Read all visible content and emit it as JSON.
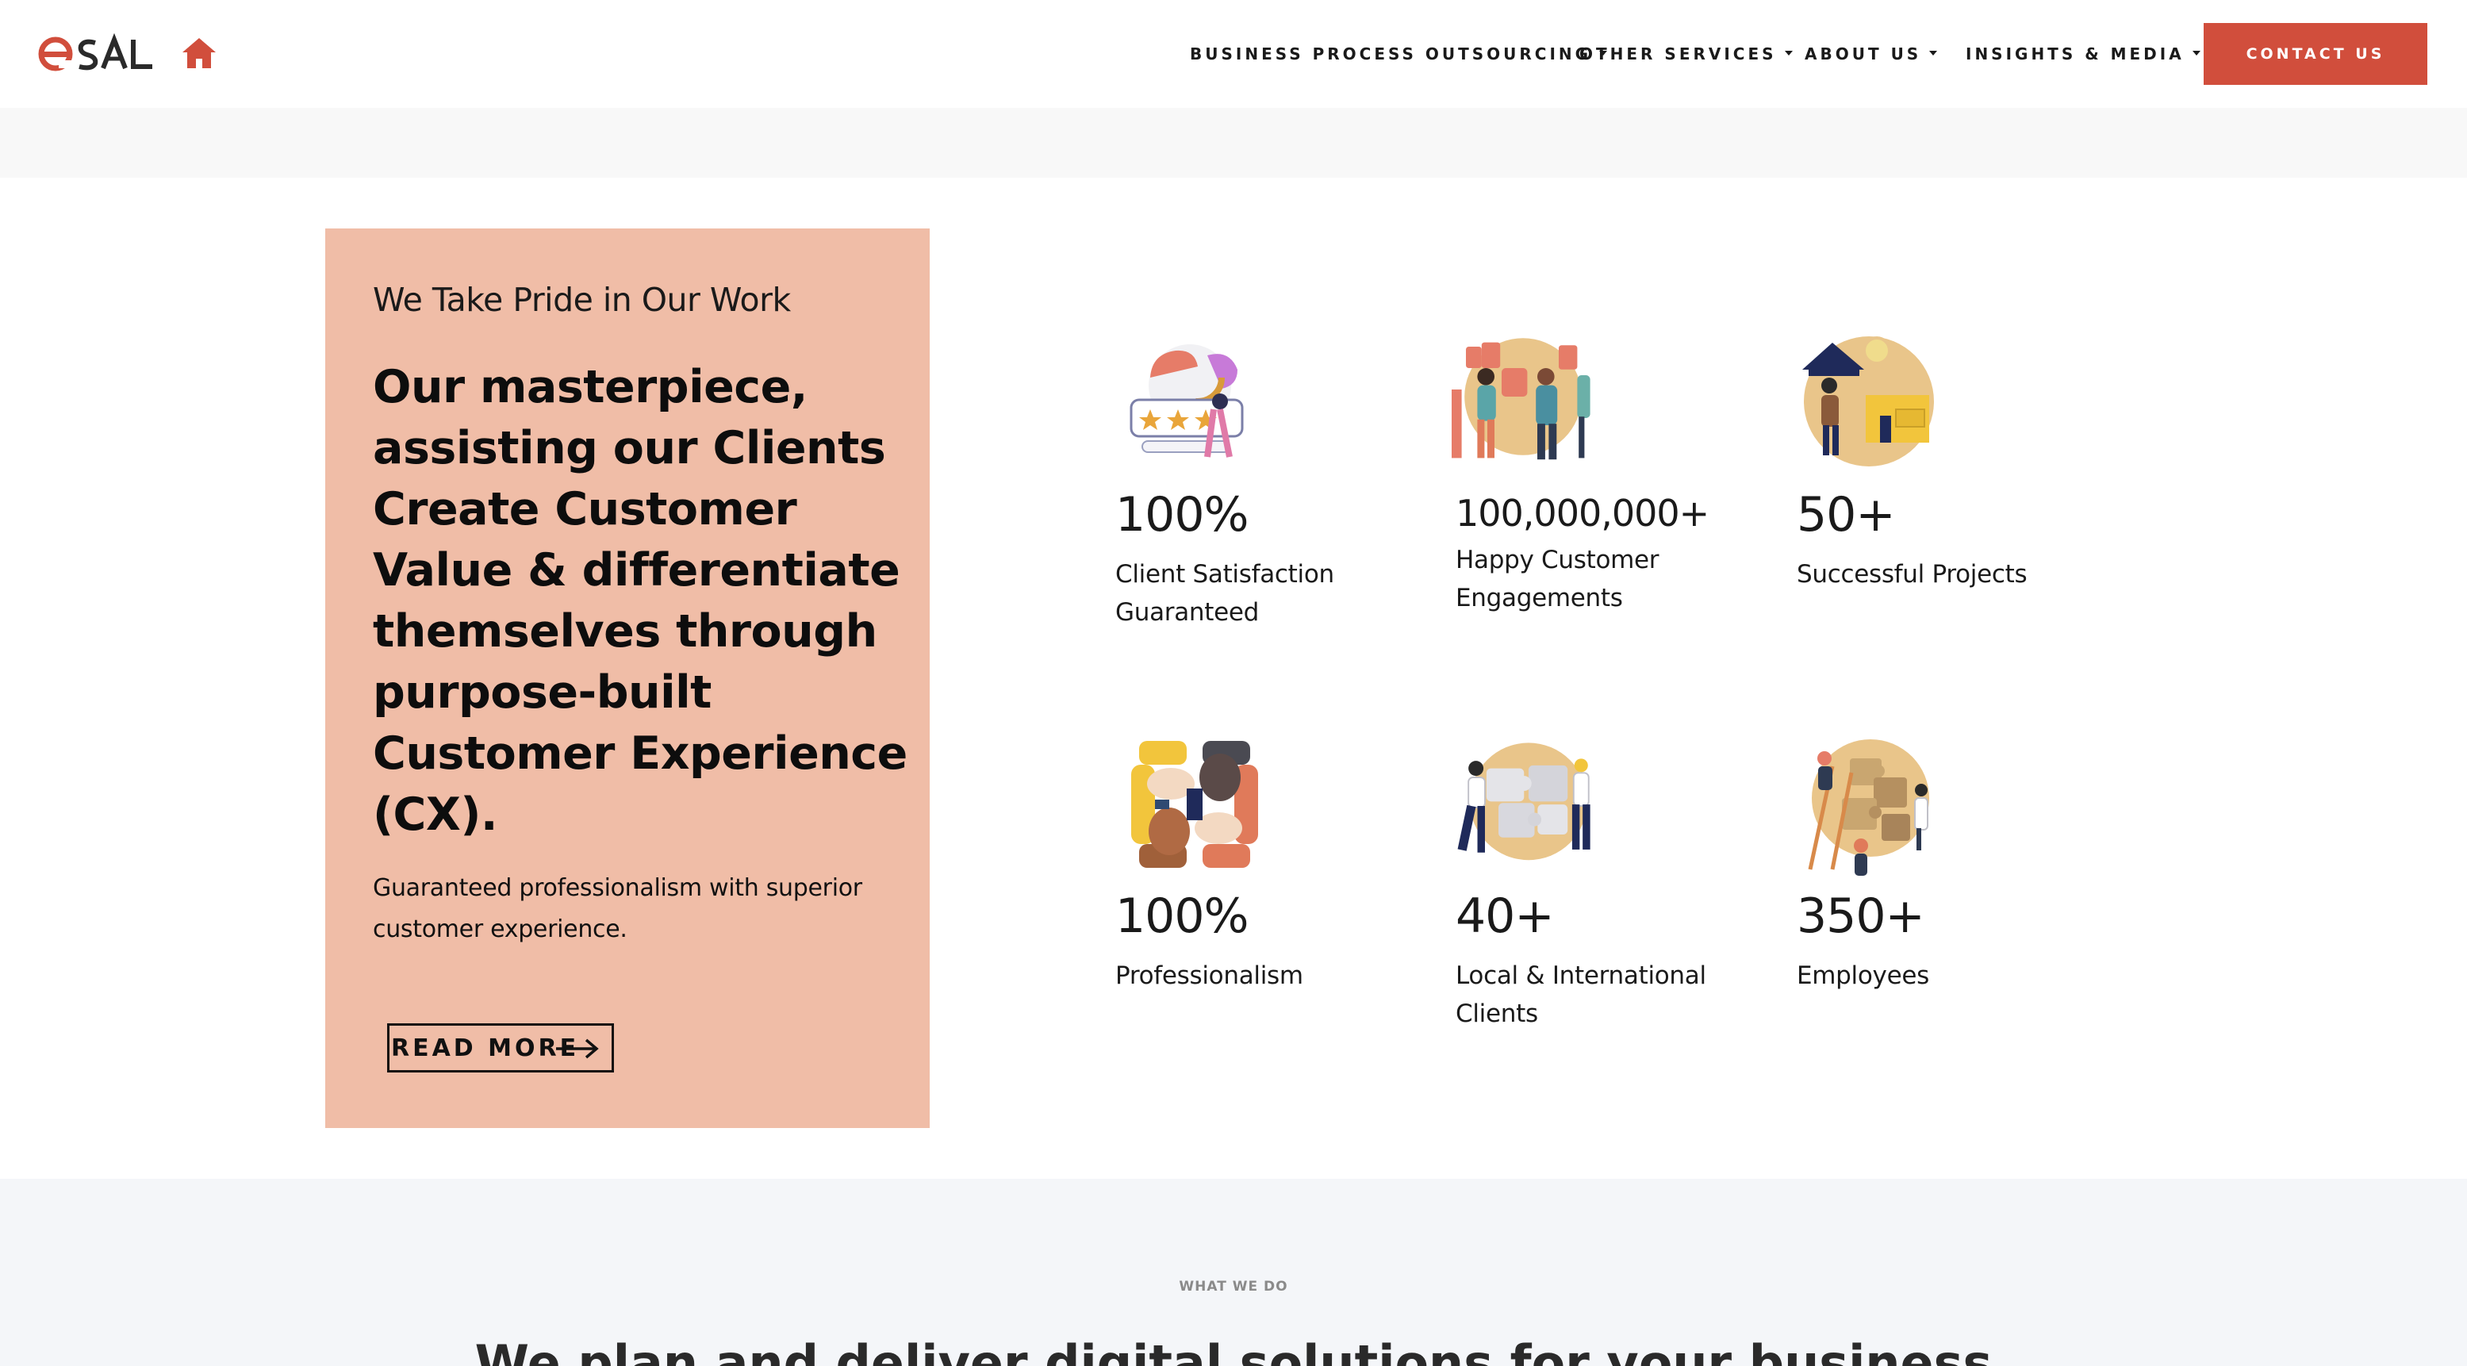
{
  "header": {
    "logo_text": "eSAL",
    "nav": [
      {
        "label": "BUSINESS PROCESS OUTSOURCING"
      },
      {
        "label": "OTHER SERVICES"
      },
      {
        "label": "ABOUT US"
      },
      {
        "label": "INSIGHTS & MEDIA"
      }
    ],
    "contact_label": "CONTACT US"
  },
  "colors": {
    "brand_red": "#d14e3c",
    "card_peach": "#f0bda7",
    "illustration_gold": "#e9c58a"
  },
  "card": {
    "subtitle": "We Take Pride in Our Work",
    "title": "Our masterpiece, assisting our Clients Create Customer Value & differentiate themselves through purpose-built Customer Experience (CX).",
    "description": "Guaranteed professionalism with superior customer experience.",
    "read_more": "READ MORE"
  },
  "stats": [
    {
      "value": "100%",
      "label": "Client Satisfaction Guaranteed",
      "icon": "rating-icon"
    },
    {
      "value": "100,000,000+",
      "label": "Happy Customer Engagements",
      "icon": "thumbs-up-people-icon"
    },
    {
      "value": "50+",
      "label": "Successful Projects",
      "icon": "project-house-icon"
    },
    {
      "value": "100%",
      "label": "Professionalism",
      "icon": "linked-hands-icon"
    },
    {
      "value": "40+",
      "label": "Local & International Clients",
      "icon": "puzzle-team-icon"
    },
    {
      "value": "350+",
      "label": "Employees",
      "icon": "building-puzzle-icon"
    }
  ],
  "bottom": {
    "eyebrow": "WHAT WE DO",
    "headline": "We plan and deliver digital solutions for your business"
  }
}
